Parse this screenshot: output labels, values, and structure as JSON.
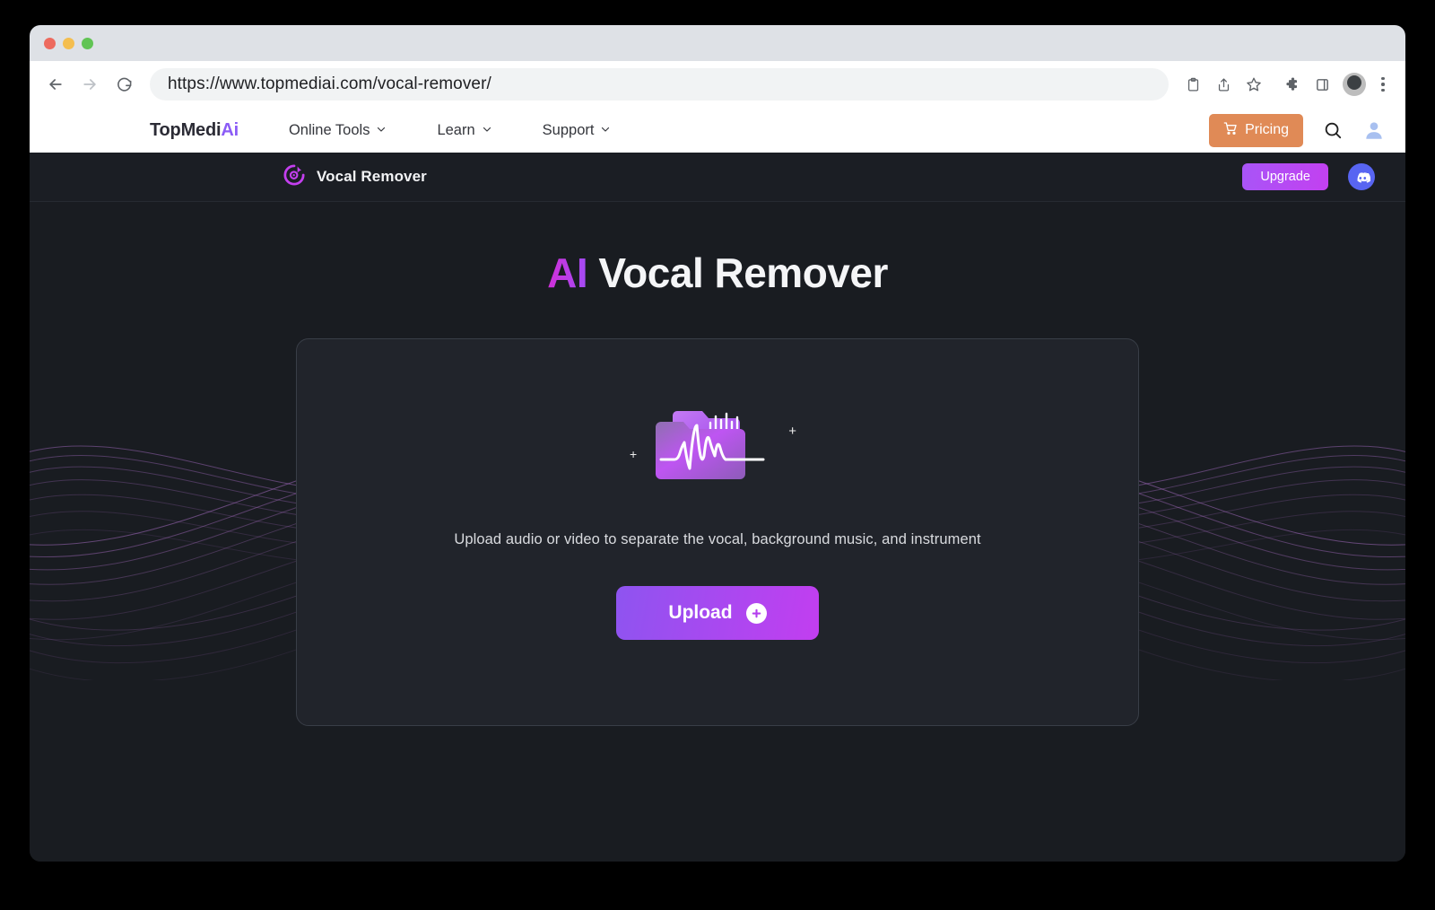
{
  "browser": {
    "url": "https://www.topmediai.com/vocal-remover/",
    "back_icon": "back-arrow-icon",
    "forward_icon": "forward-arrow-icon",
    "reload_icon": "reload-icon",
    "toolbar_icons": [
      "clipboard-icon",
      "share-icon",
      "bookmark-star-icon",
      "extensions-puzzle-icon",
      "side-panel-icon"
    ],
    "profile_icon": "profile-avatar-icon",
    "menu_icon": "kebab-menu-icon"
  },
  "site_nav": {
    "brand_primary": "TopMedi",
    "brand_accent": "Ai",
    "links": [
      {
        "label": "Online Tools",
        "chevron": "chevron-down-icon"
      },
      {
        "label": "Learn",
        "chevron": "chevron-down-icon"
      },
      {
        "label": "Support",
        "chevron": "chevron-down-icon"
      }
    ],
    "pricing_label": "Pricing",
    "pricing_icon": "shopping-cart-icon",
    "pricing_color": "#E08A56",
    "search_icon": "search-icon",
    "account_icon": "user-avatar-icon"
  },
  "app_header": {
    "logo_icon": "vocal-remover-logo-icon",
    "title": "Vocal Remover",
    "upgrade_label": "Upgrade",
    "discord_icon": "discord-icon",
    "discord_color": "#5865F2",
    "upgrade_gradient_from": "#A855F7",
    "upgrade_gradient_to": "#C340F0"
  },
  "hero": {
    "title_accent": "AI",
    "title_rest": " Vocal Remover"
  },
  "drop_card": {
    "art_icon": "audio-folder-waveform-icon",
    "sparkle_icon": "plus-sparkle-icon",
    "description": "Upload audio or video to separate the vocal, background music, and instrument",
    "upload_label": "Upload",
    "upload_icon": "plus-circle-icon",
    "upload_gradient_from": "#8E54F0",
    "upload_gradient_to": "#C23EF0"
  },
  "theme": {
    "page_bg": "#191C21",
    "card_bg": "#21242B",
    "card_border": "#393E47",
    "header_bg": "#1B1E24",
    "wave_color": "#8E5FA8"
  }
}
